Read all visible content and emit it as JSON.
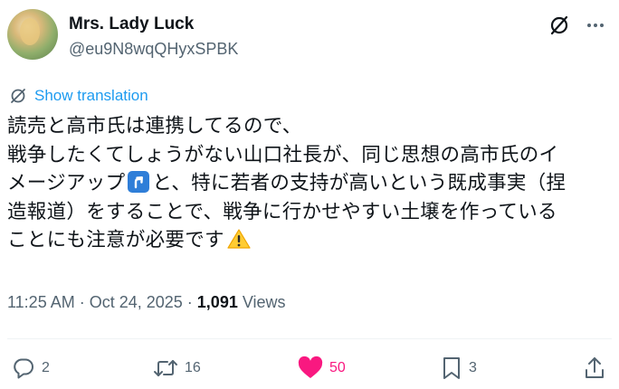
{
  "author": {
    "name": "Mrs. Lady Luck",
    "handle": "@eu9N8wqQHyxSPBK"
  },
  "icons": {
    "avatar": "profile-avatar",
    "grok": "grok-slash-icon",
    "more": "more-dots-icon",
    "translate": "translate-globe-icon",
    "reply": "reply-bubble-icon",
    "repost": "repost-arrows-icon",
    "like": "heart-filled-icon",
    "bookmark": "bookmark-icon",
    "share": "share-upload-icon"
  },
  "translate_label": "Show translation",
  "tweet": {
    "line1": "読売と高市氏は連携してるので、",
    "line2": "戦争したくてしょうがない山口社長が、同じ思想の高市氏のイ",
    "line3a": "メージアップ",
    "line3b": "と、特に若者の支持が高いという既成事実（捏",
    "line4": "造報道）をすることで、戦争に行かせやすい土壌を作っている",
    "line5": "ことにも注意が必要です"
  },
  "meta": {
    "time": "11:25 AM",
    "separator1": " · ",
    "date": "Oct 24, 2025",
    "separator2": " · ",
    "views_count": "1,091",
    "views_label": " Views"
  },
  "actions": {
    "replies": "2",
    "reposts": "16",
    "likes": "50",
    "bookmarks": "3"
  },
  "colors": {
    "accent": "#1d9bf0",
    "like": "#f91880",
    "muted": "#536471",
    "text": "#0f1419"
  }
}
